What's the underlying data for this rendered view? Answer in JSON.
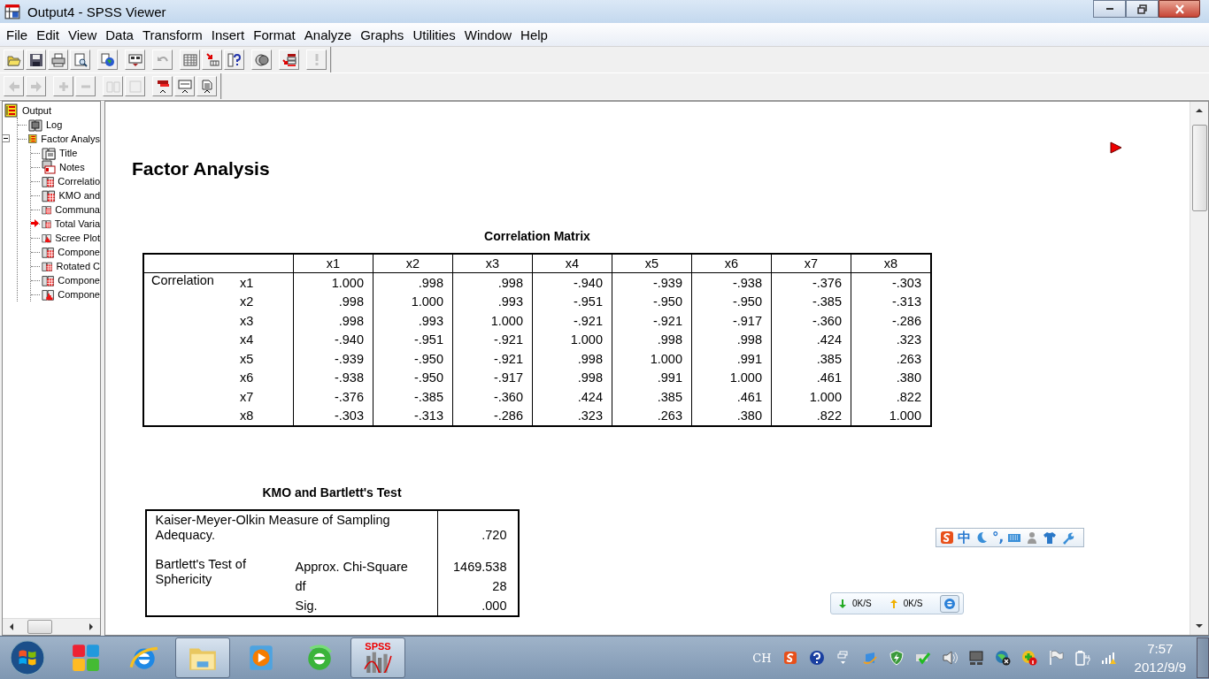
{
  "window": {
    "title": "Output4 - SPSS Viewer"
  },
  "menu": [
    "File",
    "Edit",
    "View",
    "Data",
    "Transform",
    "Insert",
    "Format",
    "Analyze",
    "Graphs",
    "Utilities",
    "Window",
    "Help"
  ],
  "toolbars": [
    {
      "groups": [
        [
          {
            "kind": "open",
            "disabled": false
          },
          {
            "kind": "save",
            "disabled": false
          },
          {
            "kind": "print",
            "disabled": false
          },
          {
            "kind": "preview",
            "disabled": false
          }
        ],
        [
          {
            "kind": "export",
            "disabled": false
          }
        ],
        [
          {
            "kind": "recall",
            "disabled": false
          }
        ],
        [
          {
            "kind": "undo",
            "disabled": true
          }
        ],
        [
          {
            "kind": "grid",
            "disabled": false
          },
          {
            "kind": "goto",
            "disabled": false
          },
          {
            "kind": "vars",
            "disabled": false
          }
        ],
        [
          {
            "kind": "sets",
            "disabled": false
          }
        ],
        [
          {
            "kind": "select",
            "disabled": false
          }
        ],
        [
          {
            "kind": "exclaim",
            "disabled": true
          }
        ]
      ]
    },
    {
      "groups": [
        [
          {
            "kind": "back",
            "disabled": true
          },
          {
            "kind": "forward",
            "disabled": true
          }
        ],
        [
          {
            "kind": "expand",
            "disabled": true
          },
          {
            "kind": "collapse",
            "disabled": true
          }
        ],
        [
          {
            "kind": "show",
            "disabled": true
          },
          {
            "kind": "hide",
            "disabled": true
          }
        ],
        [
          {
            "kind": "heading",
            "disabled": false
          },
          {
            "kind": "titlebox",
            "disabled": false
          },
          {
            "kind": "textdoc",
            "disabled": false
          }
        ]
      ]
    }
  ],
  "outline": [
    {
      "label": "Output",
      "kind": "book",
      "current": false,
      "children": [
        {
          "label": "Log",
          "kind": "log",
          "current": false
        },
        {
          "label": "Factor Analys",
          "kind": "book",
          "current": false,
          "expanded": true,
          "children": [
            {
              "label": "Title",
              "kind": "title",
              "current": false
            },
            {
              "label": "Notes",
              "kind": "notes",
              "current": false
            },
            {
              "label": "Correlatio",
              "kind": "table",
              "current": false
            },
            {
              "label": "KMO and",
              "kind": "table",
              "current": false
            },
            {
              "label": "Communa",
              "kind": "table",
              "current": false
            },
            {
              "label": "Total Varia",
              "kind": "table",
              "current": true
            },
            {
              "label": "Scree Plot",
              "kind": "chart",
              "current": false
            },
            {
              "label": "Compone",
              "kind": "table",
              "current": false
            },
            {
              "label": "Rotated C",
              "kind": "table",
              "current": false
            },
            {
              "label": "Compone",
              "kind": "table",
              "current": false
            },
            {
              "label": "Compone",
              "kind": "chart",
              "current": false
            }
          ]
        }
      ]
    }
  ],
  "heading": "Factor Analysis",
  "correlation_matrix": {
    "title": "Correlation Matrix",
    "group_label": "Correlation",
    "columns": [
      "x1",
      "x2",
      "x3",
      "x4",
      "x5",
      "x6",
      "x7",
      "x8"
    ],
    "rows": [
      {
        "variable": "x1",
        "values": [
          "1.000",
          ".998",
          ".998",
          "-.940",
          "-.939",
          "-.938",
          "-.376",
          "-.303"
        ]
      },
      {
        "variable": "x2",
        "values": [
          ".998",
          "1.000",
          ".993",
          "-.951",
          "-.950",
          "-.950",
          "-.385",
          "-.313"
        ]
      },
      {
        "variable": "x3",
        "values": [
          ".998",
          ".993",
          "1.000",
          "-.921",
          "-.921",
          "-.917",
          "-.360",
          "-.286"
        ]
      },
      {
        "variable": "x4",
        "values": [
          "-.940",
          "-.951",
          "-.921",
          "1.000",
          ".998",
          ".998",
          ".424",
          ".323"
        ]
      },
      {
        "variable": "x5",
        "values": [
          "-.939",
          "-.950",
          "-.921",
          ".998",
          "1.000",
          ".991",
          ".385",
          ".263"
        ]
      },
      {
        "variable": "x6",
        "values": [
          "-.938",
          "-.950",
          "-.917",
          ".998",
          ".991",
          "1.000",
          ".461",
          ".380"
        ]
      },
      {
        "variable": "x7",
        "values": [
          "-.376",
          "-.385",
          "-.360",
          ".424",
          ".385",
          ".461",
          "1.000",
          ".822"
        ]
      },
      {
        "variable": "x8",
        "values": [
          "-.303",
          "-.313",
          "-.286",
          ".323",
          ".263",
          ".380",
          ".822",
          "1.000"
        ]
      }
    ]
  },
  "kmo_test": {
    "title": "KMO and Bartlett's Test",
    "kmo_label": "Kaiser-Meyer-Olkin Measure of Sampling Adequacy.",
    "kmo_value": ".720",
    "bartlett_label": "Bartlett's Test of Sphericity",
    "bartlett_rows": [
      {
        "label": "Approx. Chi-Square",
        "value": "1469.538"
      },
      {
        "label": "df",
        "value": "28"
      },
      {
        "label": "Sig.",
        "value": ".000"
      }
    ]
  },
  "ime_bar": [
    {
      "kind": "logo"
    },
    {
      "kind": "text",
      "text": "中"
    },
    {
      "kind": "moon"
    },
    {
      "kind": "text",
      "text": "°,"
    },
    {
      "kind": "keyboard"
    },
    {
      "kind": "person"
    },
    {
      "kind": "shirt"
    },
    {
      "kind": "wrench"
    }
  ],
  "speed_widget": {
    "download": "0K/S",
    "upload": "0K/S"
  },
  "taskbar": {
    "apps": [
      {
        "kind": "tiles",
        "active": false
      },
      {
        "kind": "ie",
        "active": false
      },
      {
        "kind": "explorer",
        "active": true
      },
      {
        "kind": "media",
        "active": false
      },
      {
        "kind": "greene",
        "active": false
      },
      {
        "kind": "spss",
        "active": true,
        "label": "SPSS"
      }
    ],
    "language": "CH",
    "tray": [
      {
        "kind": "sogou"
      },
      {
        "kind": "help"
      },
      {
        "kind": "arrows"
      },
      {
        "kind": "update"
      },
      {
        "kind": "shield"
      },
      {
        "kind": "check"
      },
      {
        "kind": "speaker"
      },
      {
        "kind": "monitor"
      },
      {
        "kind": "globex"
      },
      {
        "kind": "plusinfo"
      },
      {
        "kind": "flag"
      },
      {
        "kind": "battery"
      },
      {
        "kind": "signal"
      }
    ],
    "time": "7:57",
    "date": "2012/9/9"
  }
}
